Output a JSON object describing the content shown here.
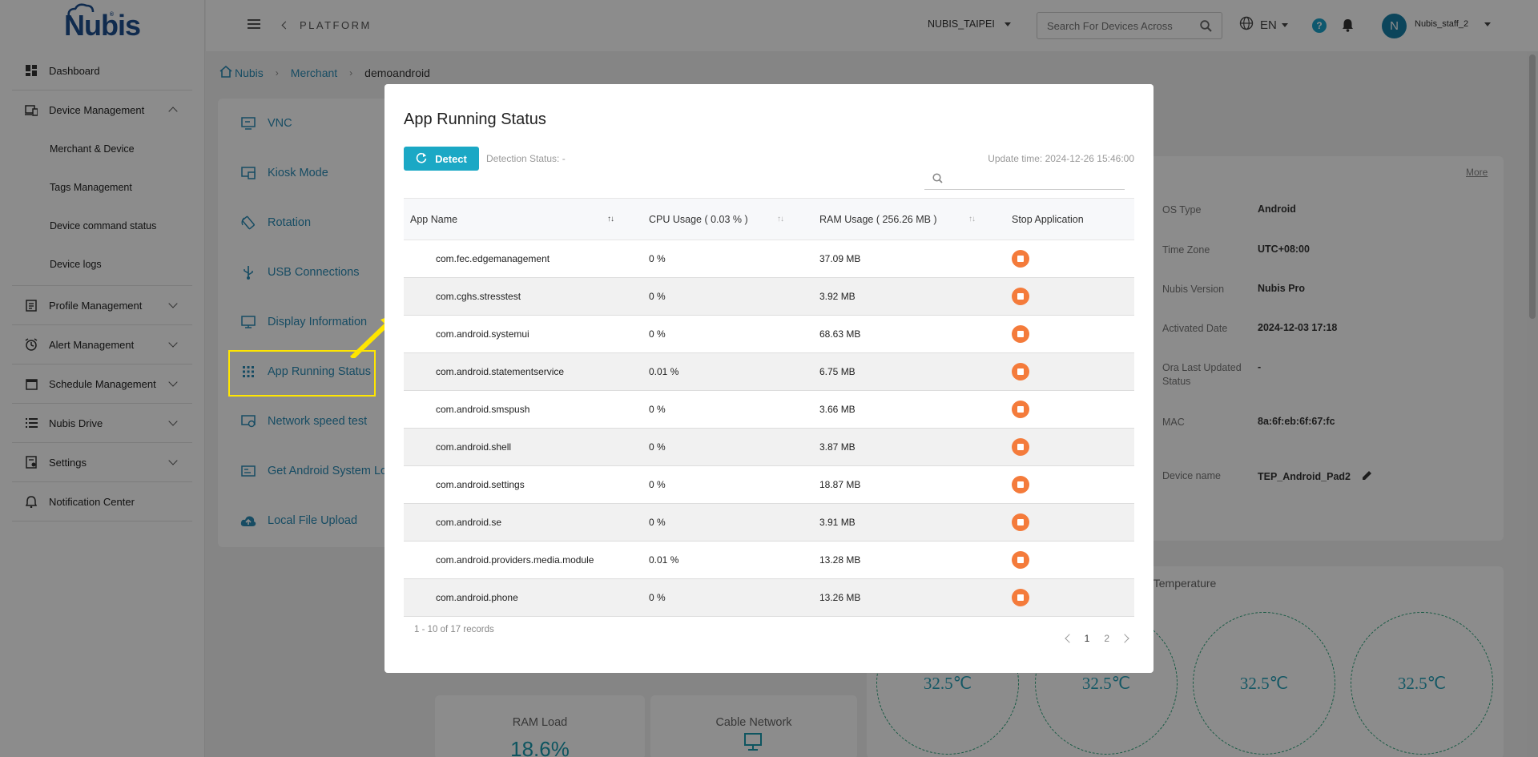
{
  "app": {
    "logo": "Nubis",
    "logo_mark": "®"
  },
  "sidebar": {
    "items": [
      {
        "label": "Dashboard",
        "icon": "dashboard-icon"
      },
      {
        "label": "Device Management",
        "icon": "device-icon",
        "expanded": true,
        "children": [
          "Merchant & Device",
          "Tags Management",
          "Device command status",
          "Device logs"
        ]
      },
      {
        "label": "Profile Management",
        "icon": "profile-icon"
      },
      {
        "label": "Alert Management",
        "icon": "alarm-icon"
      },
      {
        "label": "Schedule Management",
        "icon": "calendar-icon"
      },
      {
        "label": "Nubis Drive",
        "icon": "list-icon"
      },
      {
        "label": "Settings",
        "icon": "settings-icon"
      },
      {
        "label": "Notification Center",
        "icon": "bell-icon"
      }
    ]
  },
  "header": {
    "platform": "PLATFORM",
    "region": "NUBIS_TAIPEI",
    "search_placeholder": "Search For Devices Across",
    "language": "EN",
    "help": "?",
    "avatar_initial": "N",
    "username": "Nubis_staff_2"
  },
  "breadcrumb": {
    "home": "Nubis",
    "merchant": "Merchant",
    "current": "demoandroid"
  },
  "features": [
    {
      "label": "VNC",
      "icon": "vnc-icon"
    },
    {
      "label": "Kiosk Mode",
      "icon": "kiosk-icon"
    },
    {
      "label": "Rotation",
      "icon": "rotation-icon"
    },
    {
      "label": "USB Connections",
      "icon": "usb-icon"
    },
    {
      "label": "Display Information",
      "icon": "monitor-icon"
    },
    {
      "label": "App Running Status",
      "icon": "apps-grid-icon"
    },
    {
      "label": "Network speed test",
      "icon": "network-icon"
    },
    {
      "label": "Get Android System Lo",
      "icon": "log-icon"
    },
    {
      "label": "Local File Upload",
      "icon": "upload-icon"
    }
  ],
  "device_info": {
    "more": "More",
    "rows": [
      {
        "label": "OS Type",
        "value": "Android"
      },
      {
        "label": "Time Zone",
        "value": "UTC+08:00"
      },
      {
        "label": "Nubis Version",
        "value": "Nubis Pro"
      },
      {
        "label": "Activated Date",
        "value": "2024-12-03 17:18"
      },
      {
        "label": "Ora Last Updated Status",
        "value": "-"
      },
      {
        "label": "MAC",
        "value": "8a:6f:eb:6f:67:fc"
      },
      {
        "label": "Device name",
        "value": "TEP_Android_Pad2"
      }
    ]
  },
  "metrics": {
    "ram_title": "RAM Load",
    "ram_value": "18.6%",
    "cable_title": "Cable Network"
  },
  "temperature": {
    "title": "U Temperature",
    "values": [
      "32.5℃",
      "32.5℃",
      "32.5℃",
      "32.5℃"
    ]
  },
  "modal": {
    "title": "App Running Status",
    "detect_label": "Detect",
    "detection_status": "Detection Status:  -",
    "update_time": "Update time: 2024-12-26 15:46:00",
    "columns": [
      "App Name",
      "CPU Usage ( 0.03 % )",
      "RAM Usage ( 256.26 MB )",
      "Stop Application"
    ],
    "rows": [
      {
        "name": "com.fec.edgemanagement",
        "cpu": "0 %",
        "ram": "37.09 MB"
      },
      {
        "name": "com.cghs.stresstest",
        "cpu": "0 %",
        "ram": "3.92 MB"
      },
      {
        "name": "com.android.systemui",
        "cpu": "0 %",
        "ram": "68.63 MB"
      },
      {
        "name": "com.android.statementservice",
        "cpu": "0.01 %",
        "ram": "6.75 MB"
      },
      {
        "name": "com.android.smspush",
        "cpu": "0 %",
        "ram": "3.66 MB"
      },
      {
        "name": "com.android.shell",
        "cpu": "0 %",
        "ram": "3.87 MB"
      },
      {
        "name": "com.android.settings",
        "cpu": "0 %",
        "ram": "18.87 MB"
      },
      {
        "name": "com.android.se",
        "cpu": "0 %",
        "ram": "3.91 MB"
      },
      {
        "name": "com.android.providers.media.module",
        "cpu": "0.01 %",
        "ram": "13.28 MB"
      },
      {
        "name": "com.android.phone",
        "cpu": "0 %",
        "ram": "13.26 MB"
      }
    ],
    "records": "1 - 10 of 17 records",
    "pages": [
      "1",
      "2"
    ],
    "current_page": "1"
  },
  "colors": {
    "accent": "#1ba8c5",
    "link": "#2a8bb5",
    "stop": "#f47b3b",
    "highlight": "#ffe600"
  }
}
